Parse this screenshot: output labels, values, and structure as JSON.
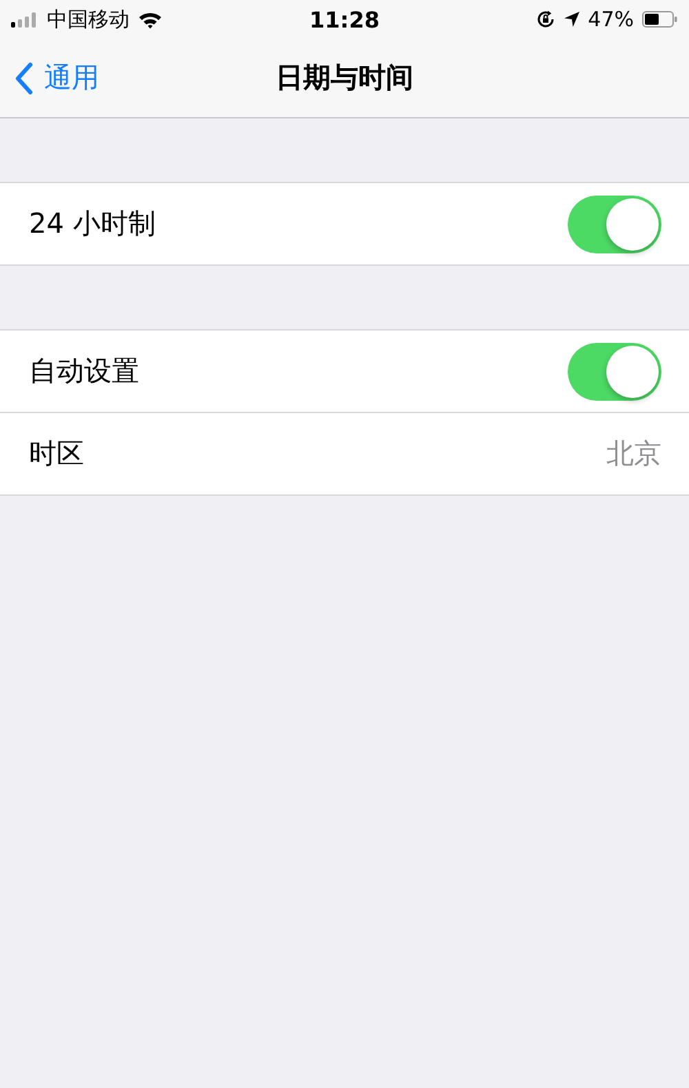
{
  "status_bar": {
    "carrier": "中国移动",
    "time": "11:28",
    "battery": "47%"
  },
  "nav_bar": {
    "back": "通用",
    "title": "日期与时间"
  },
  "sections": [
    {
      "rows": [
        {
          "kind": "toggle",
          "label": "24 小时制",
          "on": true
        }
      ]
    },
    {
      "rows": [
        {
          "kind": "toggle",
          "label": "自动设置",
          "on": true
        },
        {
          "kind": "value",
          "label": "时区",
          "value": "北京"
        }
      ]
    }
  ]
}
